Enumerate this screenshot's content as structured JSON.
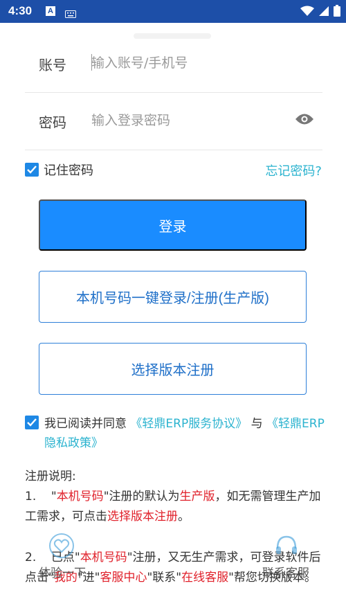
{
  "status_bar": {
    "time": "4:30",
    "notif_letter": "A"
  },
  "account_field": {
    "label": "账号",
    "placeholder": "输入账号/手机号"
  },
  "password_field": {
    "label": "密码",
    "placeholder": "输入登录密码"
  },
  "remember": {
    "label": "记住密码",
    "checked": true
  },
  "forgot_link": "忘记密码?",
  "buttons": {
    "login": "登录",
    "onekey": "本机号码一键登录/注册(生产版)",
    "register": "选择版本注册"
  },
  "agreement": {
    "prefix": "我已阅读并同意",
    "service_link": "《轻鼎ERP服务协议》",
    "joiner": "与",
    "privacy_link": "《轻鼎ERP隐私政策》"
  },
  "notes": {
    "title": "注册说明:",
    "item1": {
      "n": "1.",
      "q_open": "\"",
      "kw1": "本机号码",
      "t1": "\"注册的默认为",
      "kw2": "生产版",
      "t2": "，如无需管理生产加工需求，可点击",
      "kw3": "选择版本注册",
      "t3": "。"
    },
    "item2": {
      "n": "2.",
      "t0": "已点\"",
      "kw1": "本机号码",
      "t1": "\"注册，又无生产需求，可登录软件后点击\"",
      "kw2": "我的",
      "t2": "\"进\"",
      "kw3": "客服中心",
      "t3": "\"联系\"",
      "kw4": "在线客服",
      "t4": "\"帮您切换版本。"
    }
  },
  "floating": {
    "left_label": "体验一下",
    "right_label": "联系客服"
  },
  "colors": {
    "status_bar": "#1d4fa8",
    "primary": "#1a8cff",
    "link": "#2bb3cf",
    "highlight": "#e0202a"
  }
}
